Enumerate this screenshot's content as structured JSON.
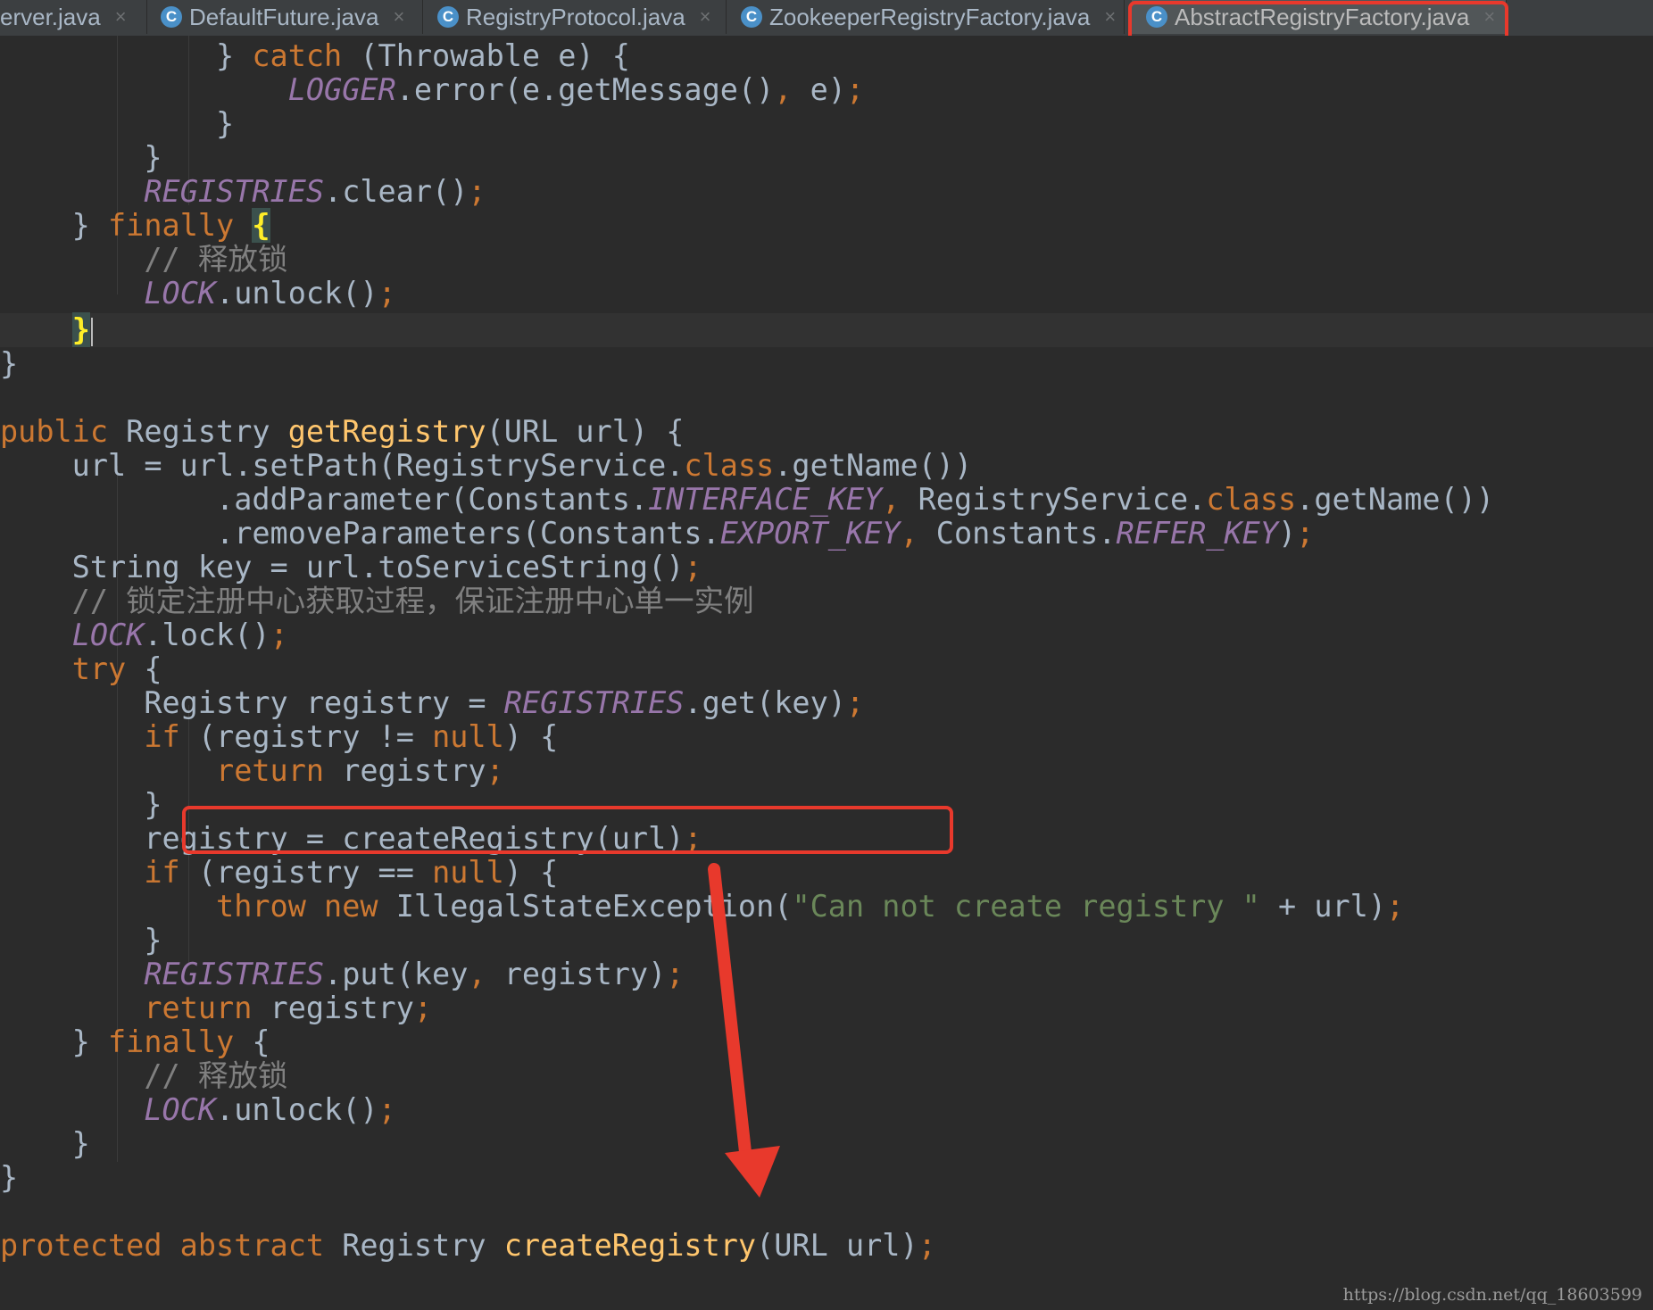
{
  "tabs": [
    {
      "label": "erver.java",
      "icon": "class-icon"
    },
    {
      "label": "DefaultFuture.java",
      "icon": "class-icon"
    },
    {
      "label": "RegistryProtocol.java",
      "icon": "class-icon"
    },
    {
      "label": "ZookeeperRegistryFactory.java",
      "icon": "class-icon"
    },
    {
      "label": "AbstractRegistryFactory.java",
      "icon": "abstract-class-icon",
      "active": true
    }
  ],
  "tab_close_glyph": "×",
  "tab_icon_letter": "C",
  "code": {
    "l1": {
      "a": "            } ",
      "b": "catch",
      "c": " (Throwable e) {"
    },
    "l2": {
      "a": "                ",
      "b": "LOGGER",
      "c": ".error(e.getMessage()",
      "d": ",",
      "e": " e)",
      "f": ";"
    },
    "l3": {
      "a": "            }"
    },
    "l4": {
      "a": "        }"
    },
    "l5": {
      "a": "        ",
      "b": "REGISTRIES",
      "c": ".clear()",
      "d": ";"
    },
    "l6": {
      "a": "    } ",
      "b": "finally",
      "c": " ",
      "d": "{"
    },
    "l7": {
      "a": "        // 释放锁"
    },
    "l8": {
      "a": "        ",
      "b": "LOCK",
      "c": ".unlock()",
      "d": ";"
    },
    "l9": {
      "a": "    ",
      "b": "}"
    },
    "l10": {
      "a": "}"
    },
    "l11": {
      "a": "public",
      "b": " Registry ",
      "c": "getRegistry",
      "d": "(URL url) {"
    },
    "l12": {
      "a": "    url = url.setPath(RegistryService.",
      "b": "class",
      "c": ".getName())"
    },
    "l13": {
      "a": "            .addParameter(Constants.",
      "b": "INTERFACE_KEY",
      "c": ",",
      "d": " RegistryService.",
      "e": "class",
      "f": ".getName())"
    },
    "l14": {
      "a": "            .removeParameters(Constants.",
      "b": "EXPORT_KEY",
      "c": ",",
      "d": " Constants.",
      "e": "REFER_KEY",
      "f": ")",
      "g": ";"
    },
    "l15": {
      "a": "    String key = url.toServiceString()",
      "b": ";"
    },
    "l16": {
      "a": "    // 锁定注册中心获取过程，保证注册中心单一实例"
    },
    "l17": {
      "a": "    ",
      "b": "LOCK",
      "c": ".lock()",
      "d": ";"
    },
    "l18": {
      "a": "    ",
      "b": "try",
      "c": " {"
    },
    "l19": {
      "a": "        Registry registry = ",
      "b": "REGISTRIES",
      "c": ".get(key)",
      "d": ";"
    },
    "l20": {
      "a": "        ",
      "b": "if",
      "c": " (registry != ",
      "d": "null",
      "e": ") {"
    },
    "l21": {
      "a": "            ",
      "b": "return",
      "c": " registry",
      "d": ";"
    },
    "l22": {
      "a": "        }"
    },
    "l23": {
      "a": "        registry = createRegistry(url)",
      "b": ";"
    },
    "l24": {
      "a": "        ",
      "b": "if",
      "c": " (registry == ",
      "d": "null",
      "e": ") {"
    },
    "l25": {
      "a": "            ",
      "b": "throw new",
      "c": " IllegalStateException(",
      "d": "\"Can not create registry \"",
      "e": " + url)",
      "f": ";"
    },
    "l26": {
      "a": "        }"
    },
    "l27": {
      "a": "        ",
      "b": "REGISTRIES",
      "c": ".put(key",
      "d": ",",
      "e": " registry)",
      "f": ";"
    },
    "l28": {
      "a": "        ",
      "b": "return",
      "c": " registry",
      "d": ";"
    },
    "l29": {
      "a": "    } ",
      "b": "finally",
      "c": " {"
    },
    "l30": {
      "a": "        // 释放锁"
    },
    "l31": {
      "a": "        ",
      "b": "LOCK",
      "c": ".unlock()",
      "d": ";"
    },
    "l32": {
      "a": "    }"
    },
    "l33": {
      "a": "}"
    },
    "l34": {
      "a": "protected abstract",
      "b": " Registry ",
      "c": "createRegistry",
      "d": "(URL url)",
      "e": ";"
    }
  },
  "colors": {
    "background": "#2b2b2b",
    "keyword": "#cc7832",
    "static_field": "#9876aa",
    "comment": "#808080",
    "string": "#6a8759",
    "method_decl": "#ffc66d",
    "annotation": "#e8392c"
  },
  "watermark": "https://blog.csdn.net/qq_18603599"
}
